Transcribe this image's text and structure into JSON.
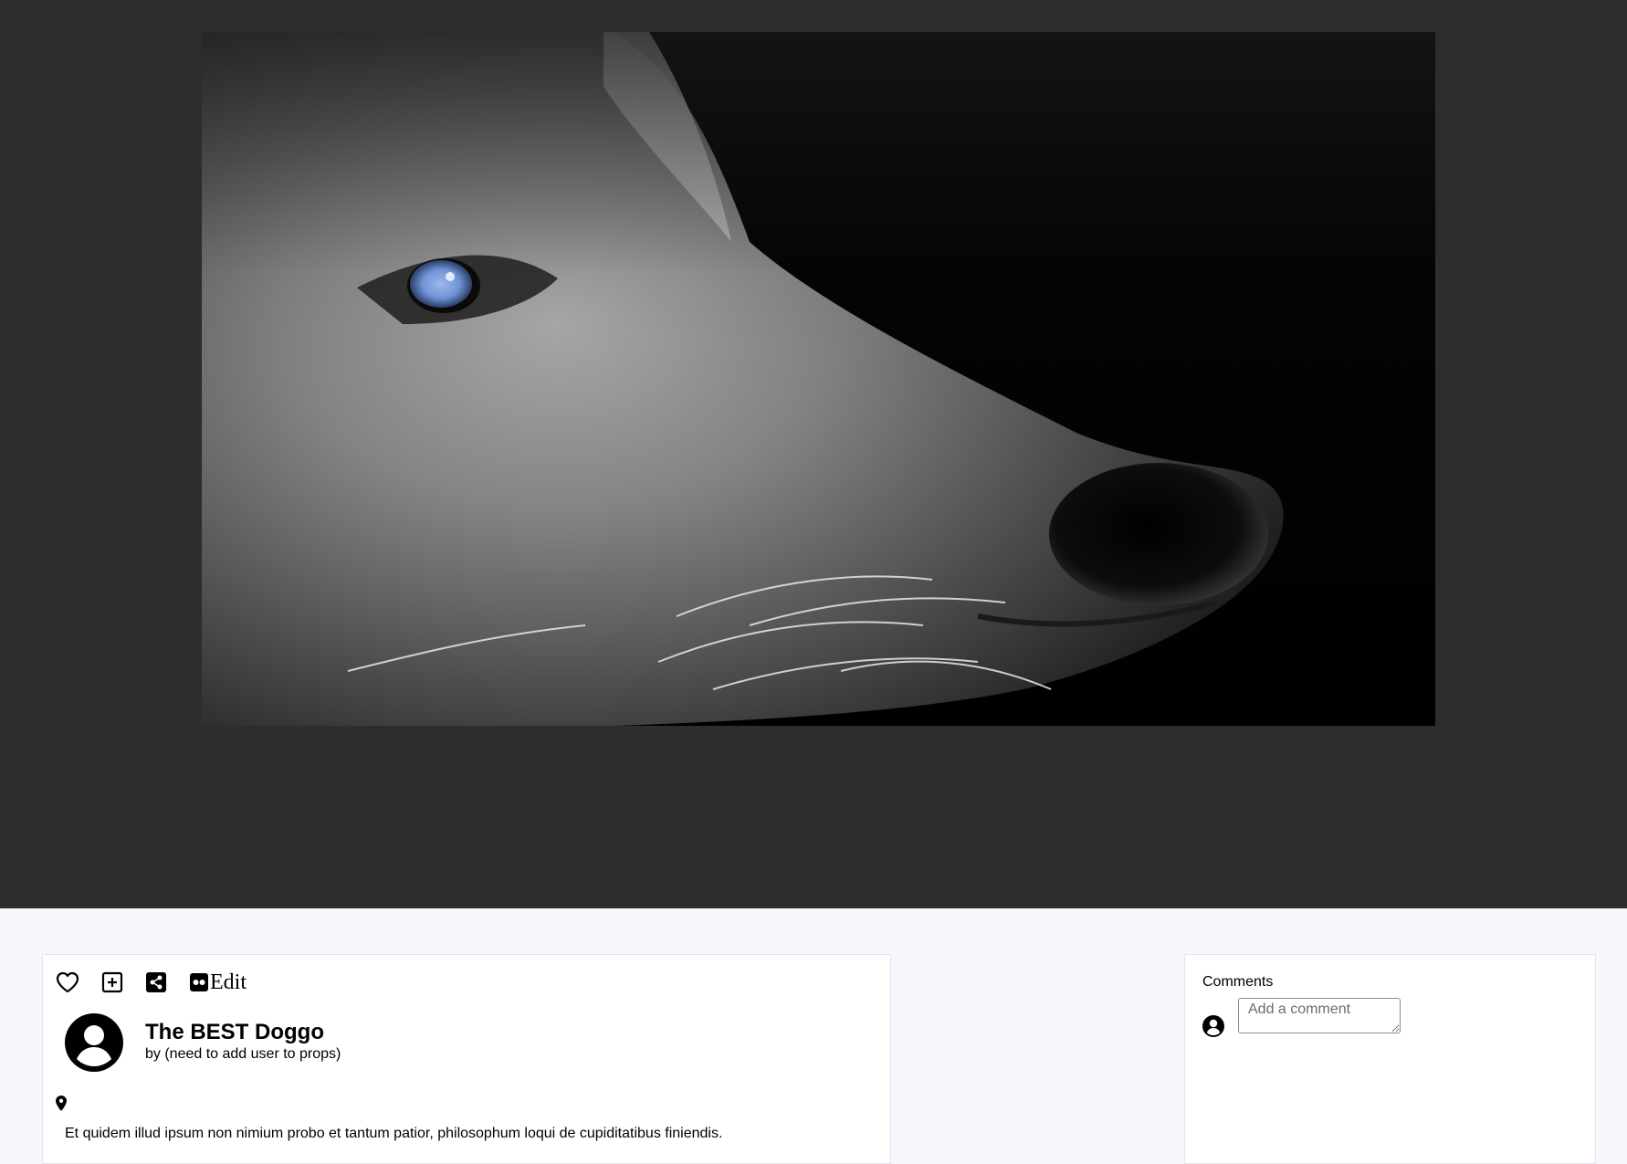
{
  "actions": {
    "like_icon": "heart-icon",
    "add_icon": "plus-square-icon",
    "share_icon": "share-icon",
    "edit_icon": "flickr-icon",
    "edit_label": "Edit"
  },
  "post": {
    "title": "The BEST Doggo",
    "author": "by (need to add user to props)",
    "location": "",
    "body": "Et quidem illud ipsum non nimium probo et tantum patior, philosophum loqui de cupiditatibus finiendis."
  },
  "comments": {
    "title": "Comments",
    "input_placeholder": "Add a comment"
  },
  "colors": {
    "hero_background": "#2d2d2d",
    "page_background": "#f7f7fd",
    "card_background": "#ffffff",
    "eye_blue": "#6f93d6"
  }
}
